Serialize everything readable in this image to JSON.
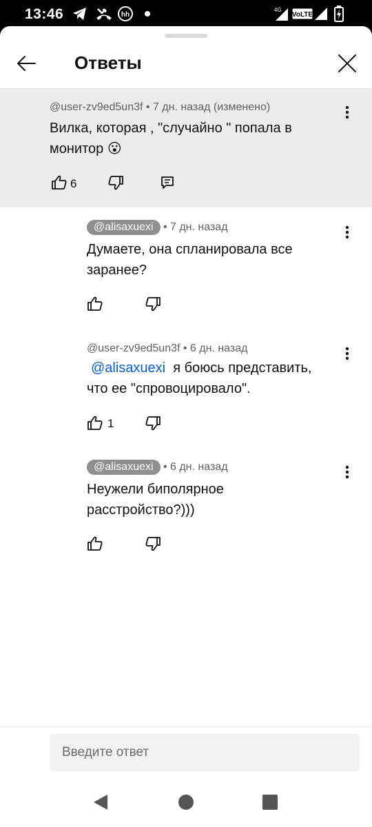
{
  "status_bar": {
    "time": "13:46",
    "left_icons": [
      "telegram-icon",
      "missed-call-icon",
      "hh-icon",
      "notification-dot-icon"
    ],
    "right_icons": [
      "4g-signal-icon",
      "volte-icon",
      "signal-icon",
      "battery-charging-icon"
    ],
    "network_label": "4G",
    "volte_label": "VoLTE",
    "hh_label": "hh"
  },
  "header": {
    "title": "Ответы"
  },
  "parent_comment": {
    "author": "@user-zv9ed5un3f",
    "meta": " • 7 дн. назад (изменено)",
    "text_line1": "Вилка, которая , \"случайно \" попала в",
    "text_line2": "монитор 😮",
    "likes": "6"
  },
  "replies": [
    {
      "author": "@alisaxuexi",
      "meta": "• 7 дн. назад",
      "text_line1": "Думаете, она спланировала все",
      "text_line2": "заранее?",
      "likes": ""
    },
    {
      "author": "@user-zv9ed5un3f",
      "meta": " • 6 дн. назад",
      "mention": "@alisaxuexi",
      "text_line1": "я боюсь представить,",
      "text_line2": "что ее \"спровоцировало\".",
      "likes": "1"
    },
    {
      "author": "@alisaxuexi",
      "meta": "• 6 дн. назад",
      "text_line1": "Неужели биполярное",
      "text_line2": "расстройство?)))",
      "likes": ""
    }
  ],
  "reply_input": {
    "placeholder": "Введите ответ"
  },
  "colors": {
    "parent_bg": "#ececec",
    "chip_bg": "#8f8f8f",
    "mention": "#065fd4"
  }
}
